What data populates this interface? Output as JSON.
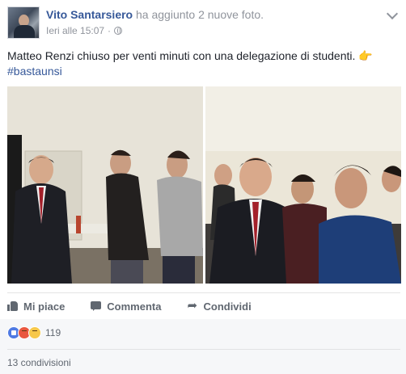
{
  "post": {
    "author": "Vito Santarsiero",
    "action": " ha aggiunto 2 nuove foto.",
    "timestamp": "Ieri alle 15:07",
    "separator": "·",
    "privacy_icon": "globe-icon",
    "text": "Matteo Renzi chiuso per venti minuti con una delegazione di studenti.",
    "hashtag": "#bastaunsi",
    "emoji": "👉"
  },
  "photos": [
    {
      "name": "photo-1"
    },
    {
      "name": "photo-2"
    }
  ],
  "actions": {
    "like_label": "Mi piace",
    "comment_label": "Commenta",
    "share_label": "Condividi"
  },
  "reactions": {
    "count": "119",
    "types": [
      "like",
      "angry",
      "sad"
    ]
  },
  "shares": "13 condivisioni",
  "colors": {
    "link": "#365899",
    "secondary_text": "#90949c",
    "action_text": "#606770",
    "footer_bg": "#f6f7f9"
  }
}
